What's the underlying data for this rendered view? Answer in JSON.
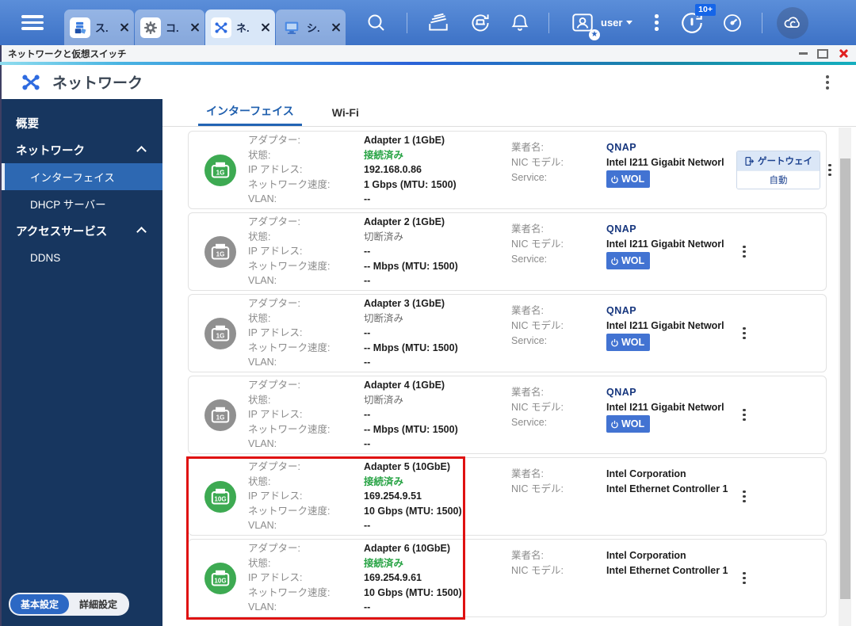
{
  "taskbar": {
    "tabs": [
      {
        "label": "ス.",
        "icon": "storage-snapshots-icon",
        "active": false
      },
      {
        "label": "コ.",
        "icon": "control-panel-icon",
        "active": false
      },
      {
        "label": "ネ.",
        "icon": "network-virtual-switch-icon",
        "active": true
      },
      {
        "label": "シ.",
        "icon": "system-monitor-icon",
        "active": false
      }
    ],
    "user_label": "user",
    "update_badge": "10+",
    "icons": {
      "star_badge": "★"
    }
  },
  "window": {
    "title": "ネットワークと仮想スイッチ"
  },
  "app_header": {
    "title": "ネットワーク"
  },
  "sidebar": {
    "items": [
      {
        "label": "概要",
        "type": "top"
      },
      {
        "label": "ネットワーク",
        "type": "group",
        "expanded": true
      },
      {
        "label": "インターフェイス",
        "type": "child",
        "active": true
      },
      {
        "label": "DHCP サーバー",
        "type": "child"
      },
      {
        "label": "アクセスサービス",
        "type": "group",
        "expanded": true
      },
      {
        "label": "DDNS",
        "type": "child"
      }
    ],
    "footer": {
      "basic": "基本設定",
      "advanced": "詳細設定"
    }
  },
  "content": {
    "tabs": [
      {
        "label": "インターフェイス",
        "active": true
      },
      {
        "label": "Wi-Fi",
        "active": false
      }
    ],
    "field_labels": {
      "adapter": "アダプター:",
      "status": "状態:",
      "ip": "IP アドレス:",
      "speed": "ネットワーク速度:",
      "vlan": "VLAN:",
      "vendor": "業者名:",
      "nic": "NIC モデル:",
      "service": "Service:"
    },
    "gateway_button": {
      "label": "ゲートウェイ",
      "value": "自動"
    },
    "wol_label": "WOL",
    "adapters": [
      {
        "name": "Adapter 1 (1GbE)",
        "speed_tag": "1G",
        "connected": true,
        "status": "接続済み",
        "ip": "192.168.0.86",
        "speed": "1 Gbps (MTU: 1500)",
        "vlan": "--",
        "vendor": "QNAP",
        "nic": "Intel I211 Gigabit Networl",
        "wol": true,
        "gateway": true,
        "highlighted": false
      },
      {
        "name": "Adapter 2 (1GbE)",
        "speed_tag": "1G",
        "connected": false,
        "status": "切断済み",
        "ip": "--",
        "speed": "-- Mbps (MTU: 1500)",
        "vlan": "--",
        "vendor": "QNAP",
        "nic": "Intel I211 Gigabit Networl",
        "wol": true,
        "gateway": false,
        "highlighted": false
      },
      {
        "name": "Adapter 3 (1GbE)",
        "speed_tag": "1G",
        "connected": false,
        "status": "切断済み",
        "ip": "--",
        "speed": "-- Mbps (MTU: 1500)",
        "vlan": "--",
        "vendor": "QNAP",
        "nic": "Intel I211 Gigabit Networl",
        "wol": true,
        "gateway": false,
        "highlighted": false
      },
      {
        "name": "Adapter 4 (1GbE)",
        "speed_tag": "1G",
        "connected": false,
        "status": "切断済み",
        "ip": "--",
        "speed": "-- Mbps (MTU: 1500)",
        "vlan": "--",
        "vendor": "QNAP",
        "nic": "Intel I211 Gigabit Networl",
        "wol": true,
        "gateway": false,
        "highlighted": false
      },
      {
        "name": "Adapter 5 (10GbE)",
        "speed_tag": "10G",
        "connected": true,
        "status": "接続済み",
        "ip": "169.254.9.51",
        "speed": "10 Gbps (MTU: 1500)",
        "vlan": "--",
        "vendor": "Intel Corporation",
        "nic": "Intel Ethernet Controller 1",
        "wol": false,
        "gateway": false,
        "highlighted": true
      },
      {
        "name": "Adapter 6 (10GbE)",
        "speed_tag": "10G",
        "connected": true,
        "status": "接続済み",
        "ip": "169.254.9.61",
        "speed": "10 Gbps (MTU: 1500)",
        "vlan": "--",
        "vendor": "Intel Corporation",
        "nic": "Intel Ethernet Controller 1",
        "wol": false,
        "gateway": false,
        "highlighted": true
      }
    ]
  },
  "colors": {
    "taskbar_blue": "#4a80d2",
    "sidebar_navy": "#17365f",
    "active_item_blue": "#2d68b2",
    "accent_blue": "#2264b4",
    "connected_green": "#27a344",
    "icon_green": "#3daa52",
    "icon_gray": "#909090",
    "wol_badge_blue": "#4273d2",
    "qnap_navy": "#15357d",
    "highlight_red": "#df1111"
  }
}
